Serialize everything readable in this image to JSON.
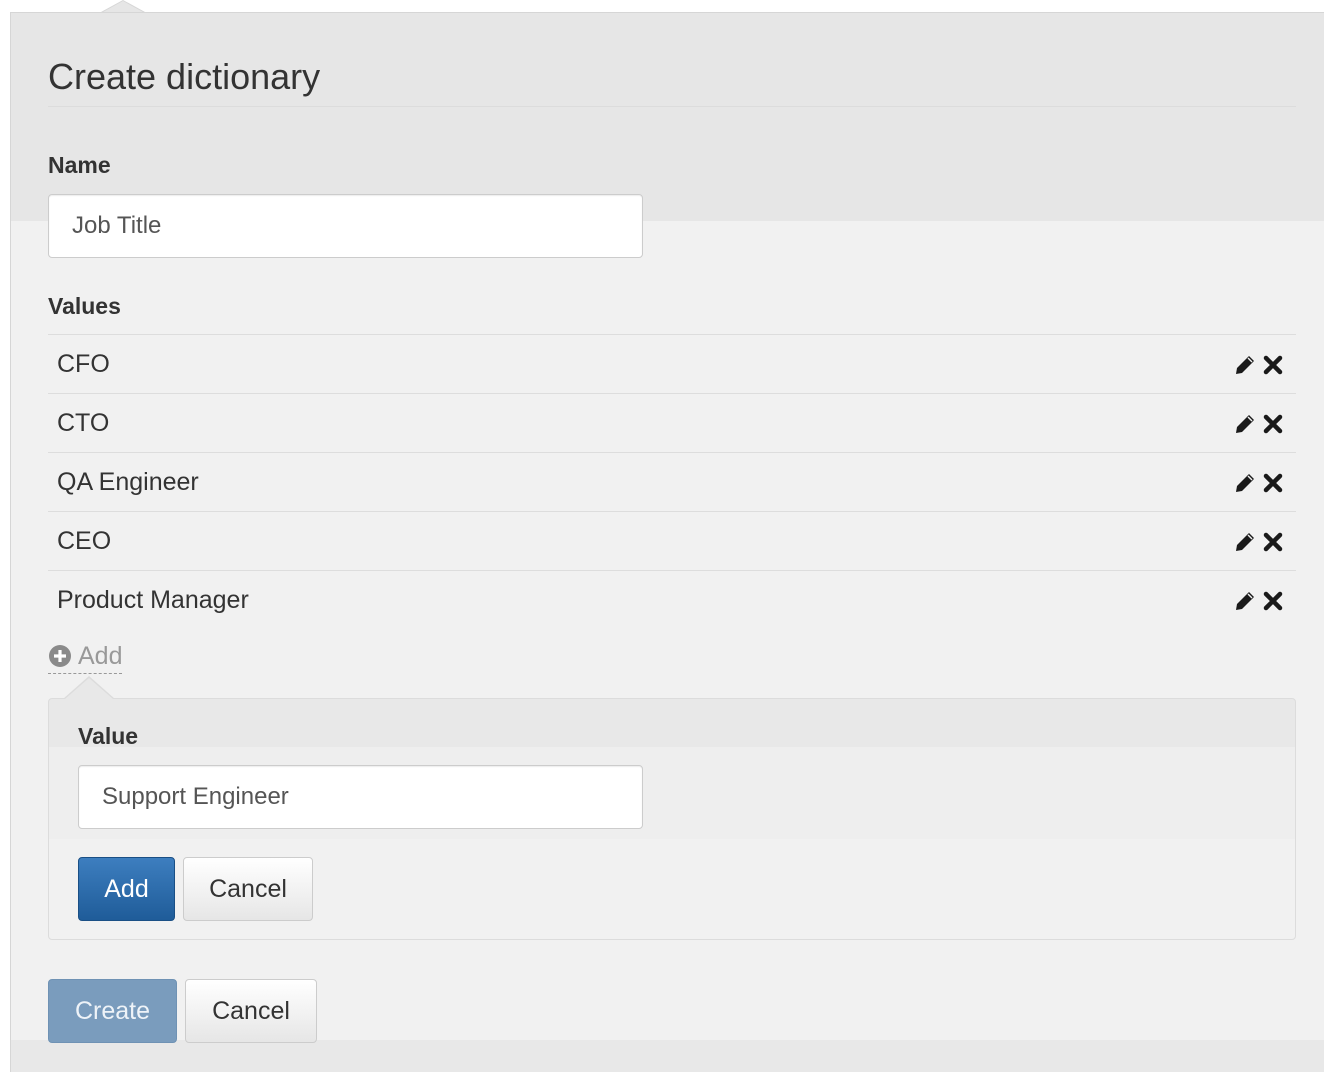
{
  "dialog": {
    "title": "Create dictionary",
    "name_label": "Name",
    "name_value": "Job Title",
    "values_label": "Values",
    "values": [
      {
        "label": "CFO"
      },
      {
        "label": "CTO"
      },
      {
        "label": "QA Engineer"
      },
      {
        "label": "CEO"
      },
      {
        "label": "Product Manager"
      }
    ],
    "row_icons": {
      "edit": "pencil-icon",
      "delete": "close-icon"
    },
    "add_link_label": "Add",
    "add_link_icon": "plus-circle-icon",
    "new_value": {
      "label": "Value",
      "input_value": "Support Engineer",
      "add_button": "Add",
      "cancel_button": "Cancel"
    },
    "create_button": "Create",
    "cancel_button": "Cancel"
  },
  "colors": {
    "primary": "#2a6aa9",
    "primary_disabled": "#7a9cbd",
    "panel_header": "#e6e6e6",
    "panel_body": "#f1f1f1",
    "link_muted": "#999999"
  }
}
